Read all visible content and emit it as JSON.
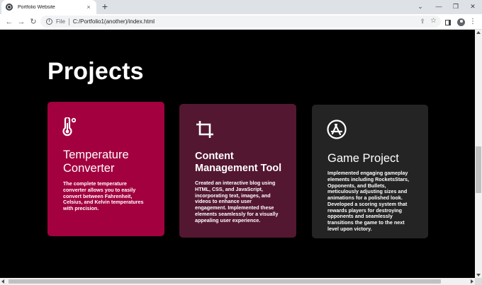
{
  "browser": {
    "tab_title": "Portfolio Website",
    "tab_close": "×",
    "new_tab": "+",
    "url_scheme": "File",
    "url": "C:/Portfolio1(another)/index.html",
    "window_controls": {
      "minimize": "—",
      "restore": "❐",
      "close": "✕",
      "expand": "⌄"
    }
  },
  "page": {
    "heading": "Projects",
    "cards": [
      {
        "title": "Temperature Converter",
        "description": "The complete temperature converter allows you to easily convert between Fahrenheit, Celsius, and Kelvin temperatures with precision.",
        "icon": "thermometer-icon",
        "color": "#a3003f"
      },
      {
        "title": "Content Management Tool",
        "description": "Created an interactive blog using HTML, CSS, and JavaScript, incorporating text, images, and videos to enhance user engagement. Implemented these elements seamlessly for a visually appealing user experience.",
        "icon": "crop-icon",
        "color": "#541731"
      },
      {
        "title": "Game Project",
        "description": "Implemented engaging gameplay elements including RocketsStars, Opponents, and Bullets, meticulously adjusting sizes and animations for a polished look. Developed a scoring system that rewards players for destroying opponents and seamlessly transitions the game to the next level upon victory.",
        "icon": "app-store-icon",
        "color": "#242424"
      }
    ]
  }
}
